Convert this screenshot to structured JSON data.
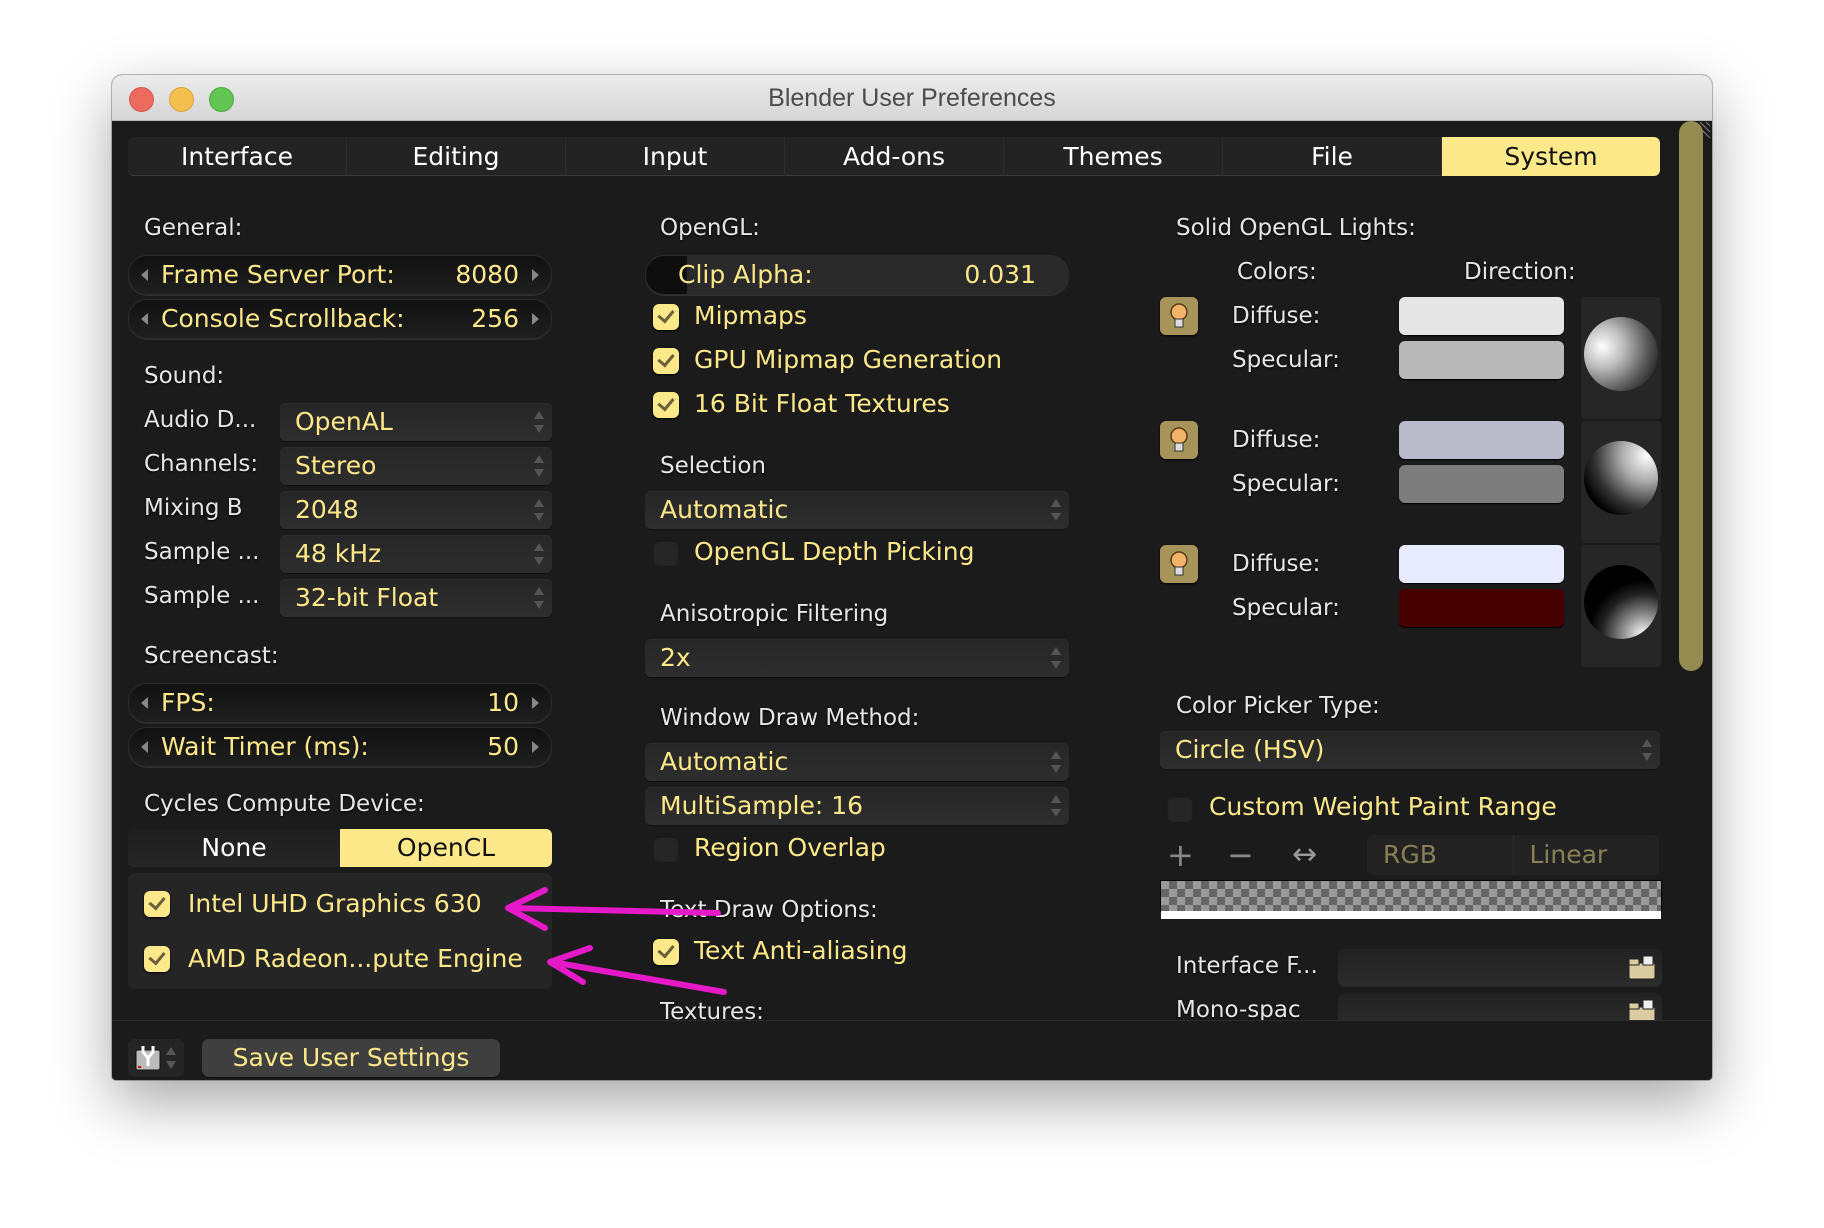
{
  "window": {
    "title": "Blender User Preferences"
  },
  "tabs": [
    {
      "label": "Interface",
      "active": false
    },
    {
      "label": "Editing",
      "active": false
    },
    {
      "label": "Input",
      "active": false
    },
    {
      "label": "Add-ons",
      "active": false
    },
    {
      "label": "Themes",
      "active": false
    },
    {
      "label": "File",
      "active": false
    },
    {
      "label": "System",
      "active": true
    }
  ],
  "general": {
    "heading": "General:",
    "frame_server_port": {
      "label": "Frame Server Port:",
      "value": "8080"
    },
    "console_scrollback": {
      "label": "Console Scrollback:",
      "value": "256"
    }
  },
  "sound": {
    "heading": "Sound:",
    "rows": [
      {
        "label": "Audio D...",
        "value": "OpenAL"
      },
      {
        "label": "Channels:",
        "value": "Stereo"
      },
      {
        "label": "Mixing B",
        "value": "2048"
      },
      {
        "label": "Sample ...",
        "value": "48 kHz"
      },
      {
        "label": "Sample ...",
        "value": "32-bit Float"
      }
    ]
  },
  "screencast": {
    "heading": "Screencast:",
    "fps": {
      "label": "FPS:",
      "value": "10"
    },
    "wait_timer": {
      "label": "Wait Timer (ms):",
      "value": "50"
    }
  },
  "cycles": {
    "heading": "Cycles Compute Device:",
    "options": [
      {
        "label": "None",
        "active": false
      },
      {
        "label": "OpenCL",
        "active": true
      }
    ],
    "devices": [
      {
        "label": "Intel UHD Graphics 630",
        "checked": true
      },
      {
        "label": "AMD Radeon...pute Engine",
        "checked": true
      }
    ]
  },
  "opengl": {
    "heading": "OpenGL:",
    "clip_alpha": {
      "label": "Clip Alpha:",
      "value": "0.031",
      "fraction": 0.031
    },
    "checkboxes": [
      {
        "label": "Mipmaps",
        "checked": true
      },
      {
        "label": "GPU Mipmap Generation",
        "checked": true
      },
      {
        "label": "16 Bit Float Textures",
        "checked": true
      }
    ],
    "selection": {
      "heading": "Selection",
      "value": "Automatic"
    },
    "depth_picking": {
      "label": "OpenGL Depth Picking",
      "checked": false
    },
    "anisotropic": {
      "heading": "Anisotropic Filtering",
      "value": "2x"
    },
    "window_draw": {
      "heading": "Window Draw Method:",
      "value": "Automatic",
      "multisample": "MultiSample: 16"
    },
    "region_overlap": {
      "label": "Region Overlap",
      "checked": false
    },
    "text_draw": {
      "heading": "Text Draw Options:",
      "anti_aliasing": {
        "label": "Text Anti-aliasing",
        "checked": true
      }
    },
    "textures_heading": "Textures:"
  },
  "lights": {
    "heading": "Solid OpenGL Lights:",
    "colors_heading": "Colors:",
    "direction_heading": "Direction:",
    "diffuse_label": "Diffuse:",
    "specular_label": "Specular:",
    "items": [
      {
        "enabled": true,
        "diffuse": "#e6e6e6",
        "specular": "#b8b8b8"
      },
      {
        "enabled": true,
        "diffuse": "#b9bbcb",
        "specular": "#7d7d7d"
      },
      {
        "enabled": true,
        "diffuse": "#e7ebfd",
        "specular": "#460000"
      }
    ]
  },
  "color_picker": {
    "heading": "Color Picker Type:",
    "value": "Circle (HSV)"
  },
  "weight_paint": {
    "label": "Custom Weight Paint Range",
    "checked": false,
    "buttons": {
      "add": "+",
      "remove": "−",
      "flip": "↔"
    },
    "color_mode": "RGB",
    "interpolation": "Linear"
  },
  "fonts": {
    "interface_label": "Interface F...",
    "interface_value": "",
    "mono_label": "Mono-spac",
    "mono_value": ""
  },
  "bottom": {
    "save_label": "Save User Settings"
  },
  "annotation_color": "#e619c9"
}
